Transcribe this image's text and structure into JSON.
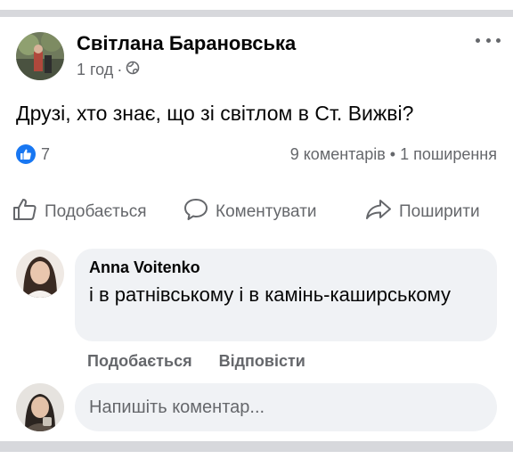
{
  "post": {
    "author": "Світлана Барановська",
    "time": "1 год",
    "separator": "·",
    "privacy_icon": "globe-icon",
    "text": "Друзі, хто знає, що зі світлом в Ст. Вижві?",
    "reaction_count": "7",
    "engagement": "9 коментарів • 1 поширення"
  },
  "actions": {
    "like": "Подобається",
    "comment": "Коментувати",
    "share": "Поширити"
  },
  "comment": {
    "author": "Anna Voitenko",
    "text": "і в ратнівському і в камінь-каширському",
    "like": "Подобається",
    "reply": "Відповісти"
  },
  "composer": {
    "placeholder": "Напишіть коментар..."
  },
  "colors": {
    "accent": "#1877f2",
    "secondary_text": "#65676b",
    "bubble": "#f0f2f5",
    "divider": "#d7d8dc"
  }
}
